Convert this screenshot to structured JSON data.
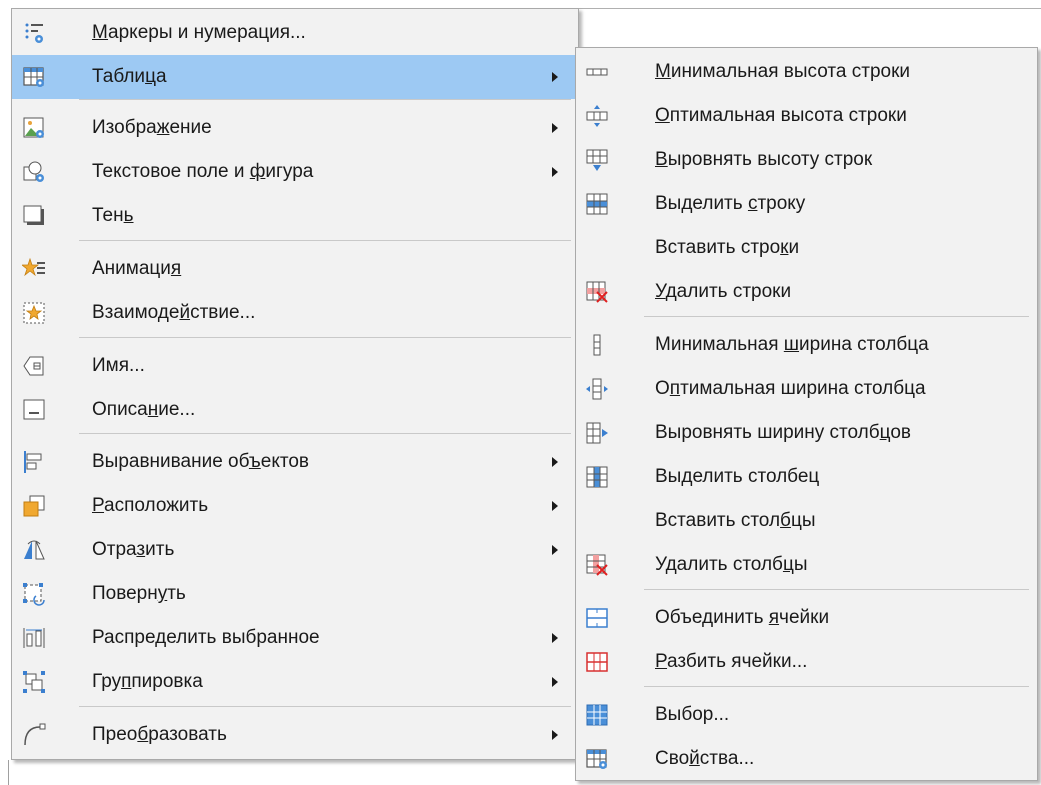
{
  "main_menu": {
    "items": [
      {
        "pre": "",
        "acc": "М",
        "post": "аркеры и нумерация...",
        "icon": "bullets-numbering-icon",
        "arrow": false
      },
      {
        "pre": "Табли",
        "acc": "ц",
        "post": "а",
        "icon": "table-icon",
        "arrow": true
      },
      {
        "pre": "Изобра",
        "acc": "ж",
        "post": "ение",
        "icon": "image-icon",
        "arrow": true
      },
      {
        "pre": "Текстовое поле и ",
        "acc": "ф",
        "post": "игура",
        "icon": "text-box-shape-icon",
        "arrow": true
      },
      {
        "pre": "Тен",
        "acc": "ь",
        "post": "",
        "icon": "shadow-icon",
        "arrow": false
      },
      {
        "pre": "Анимаци",
        "acc": "я",
        "post": "",
        "icon": "animation-icon",
        "arrow": false
      },
      {
        "pre": "Взаимоде",
        "acc": "й",
        "post": "ствие...",
        "icon": "interaction-icon",
        "arrow": false
      },
      {
        "pre": "Имя...",
        "acc": "",
        "post": "",
        "icon": "name-icon",
        "arrow": false
      },
      {
        "pre": "Описа",
        "acc": "н",
        "post": "ие...",
        "icon": "description-icon",
        "arrow": false
      },
      {
        "pre": "Выравнивание об",
        "acc": "ъ",
        "post": "ектов",
        "icon": "align-objects-icon",
        "arrow": true
      },
      {
        "pre": "",
        "acc": "Р",
        "post": "асположить",
        "icon": "arrange-icon",
        "arrow": true
      },
      {
        "pre": "Отра",
        "acc": "з",
        "post": "ить",
        "icon": "flip-icon",
        "arrow": true
      },
      {
        "pre": "Поверн",
        "acc": "у",
        "post": "ть",
        "icon": "rotate-icon",
        "arrow": false
      },
      {
        "pre": "Распре",
        "acc": "д",
        "post": "елить выбранное",
        "icon": "distribute-icon",
        "arrow": true
      },
      {
        "pre": "Гру",
        "acc": "п",
        "post": "пировка",
        "icon": "group-icon",
        "arrow": true
      },
      {
        "pre": "Прео",
        "acc": "б",
        "post": "разовать",
        "icon": "convert-icon",
        "arrow": true
      }
    ]
  },
  "sub_menu": {
    "items": [
      {
        "pre": "",
        "acc": "М",
        "post": "инимальная высота строки",
        "icon": "min-row-height-icon"
      },
      {
        "pre": "",
        "acc": "О",
        "post": "птимальная высота строки",
        "icon": "optimal-row-height-icon"
      },
      {
        "pre": "",
        "acc": "В",
        "post": "ыровнять высоту строк",
        "icon": "distribute-rows-icon"
      },
      {
        "pre": "Выделить ",
        "acc": "с",
        "post": "троку",
        "icon": "select-row-icon"
      },
      {
        "pre": "Вставить стро",
        "acc": "к",
        "post": "и",
        "icon": ""
      },
      {
        "pre": "",
        "acc": "У",
        "post": "далить строки",
        "icon": "delete-rows-icon"
      },
      {
        "pre": "Минимальная ",
        "acc": "ш",
        "post": "ирина столбца",
        "icon": "min-column-width-icon"
      },
      {
        "pre": "О",
        "acc": "п",
        "post": "тимальная ширина столбца",
        "icon": "optimal-column-width-icon"
      },
      {
        "pre": "Выровнять ширину столб",
        "acc": "ц",
        "post": "ов",
        "icon": "distribute-columns-icon"
      },
      {
        "pre": "Вы",
        "acc": "д",
        "post": "елить столбец",
        "icon": "select-column-icon"
      },
      {
        "pre": "Вставить стол",
        "acc": "б",
        "post": "цы",
        "icon": ""
      },
      {
        "pre": "Удалить столб",
        "acc": "ц",
        "post": "ы",
        "icon": "delete-columns-icon"
      },
      {
        "pre": "Объединить ",
        "acc": "я",
        "post": "чейки",
        "icon": "merge-cells-icon"
      },
      {
        "pre": "",
        "acc": "Р",
        "post": "азбить ячейки...",
        "icon": "split-cells-icon"
      },
      {
        "pre": "Выбор...",
        "acc": "",
        "post": "",
        "icon": "select-table-icon"
      },
      {
        "pre": "Сво",
        "acc": "й",
        "post": "ства...",
        "icon": "table-properties-icon"
      }
    ]
  }
}
